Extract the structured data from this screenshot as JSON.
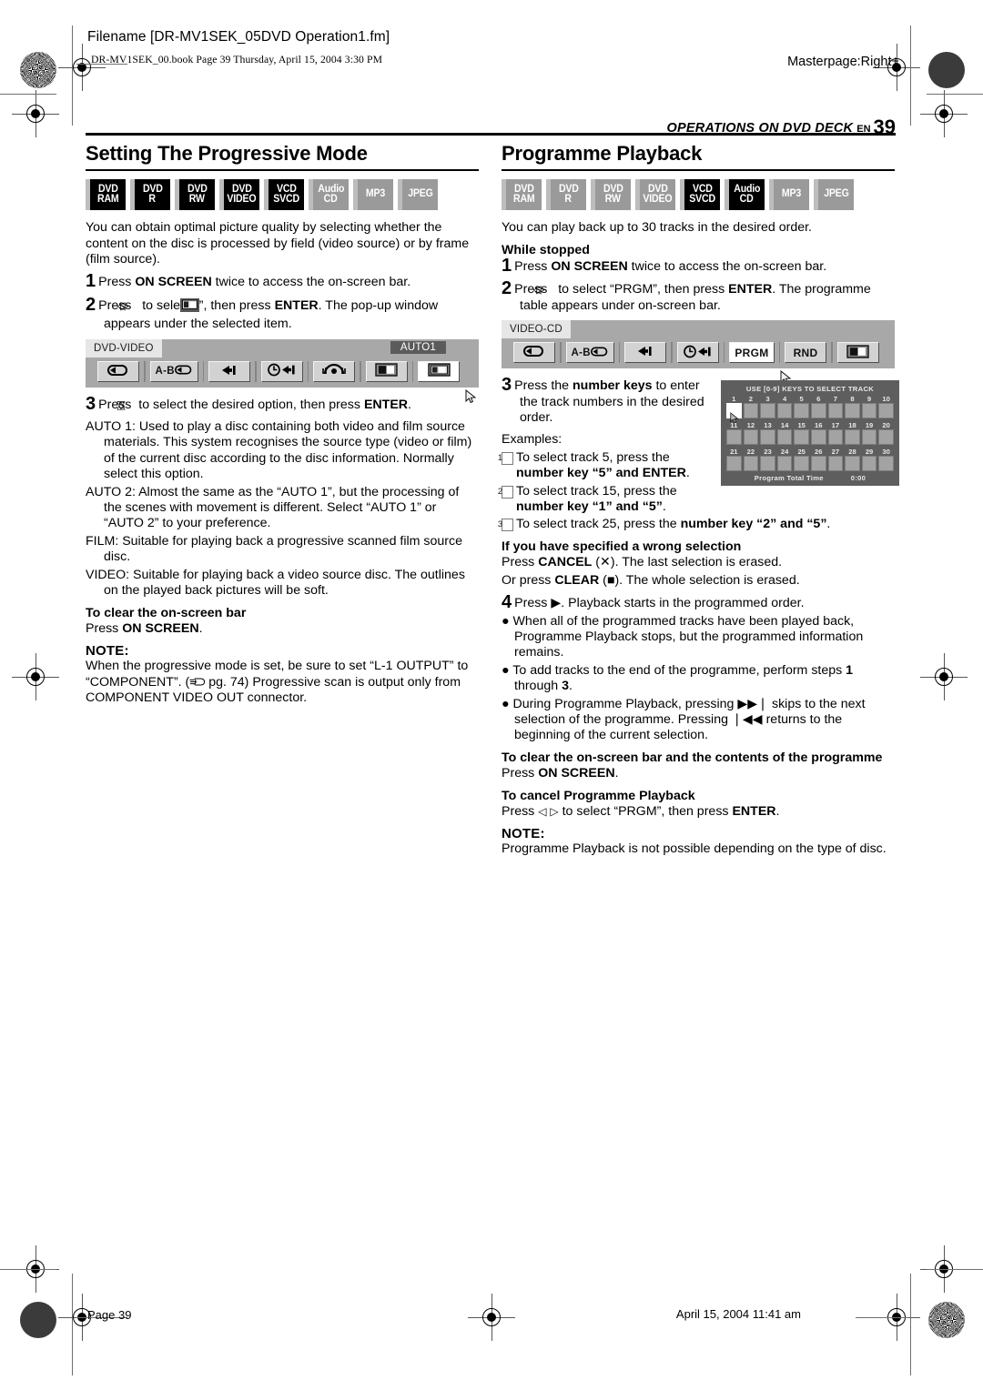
{
  "page_frame": {
    "filename_line": "Filename [DR-MV1SEK_05DVD Operation1.fm]",
    "book_line": "DR-MV1SEK_00.book  Page 39  Thursday, April 15, 2004  3:30 PM",
    "masterpage": "Masterpage:Right+",
    "running_head": "OPERATIONS ON DVD DECK",
    "running_head_en": "EN",
    "page_number": "39",
    "footer_page": "Page 39",
    "footer_date": "April 15, 2004 11:41 am"
  },
  "left_column": {
    "title": "Setting The Progressive Mode",
    "badges": [
      {
        "l1": "DVD",
        "l2": "RAM",
        "state": "on"
      },
      {
        "l1": "DVD",
        "l2": "R",
        "state": "on"
      },
      {
        "l1": "DVD",
        "l2": "RW",
        "state": "on"
      },
      {
        "l1": "DVD",
        "l2": "VIDEO",
        "state": "on"
      },
      {
        "l1": "VCD",
        "l2": "SVCD",
        "state": "on"
      },
      {
        "l1": "Audio",
        "l2": "CD",
        "state": "off"
      },
      {
        "l1": "MP3",
        "l2": "",
        "state": "off"
      },
      {
        "l1": "JPEG",
        "l2": "",
        "state": "off"
      }
    ],
    "intro": "You can obtain optimal picture quality by selecting whether the content on the disc is processed by field (video source) or by frame (film source).",
    "step1_num": "1",
    "step1_a": "Press ",
    "step1_b": "ON SCREEN",
    "step1_c": " twice to access the on-screen bar.",
    "step2_num": "2",
    "step2_a": "Press ",
    "step2_b": " to select “",
    "step2_c": "”, then press ",
    "step2_d": "ENTER",
    "step2_e": ". The pop-up window appears under the selected item.",
    "osb": {
      "disc_label": "DVD-VIDEO",
      "mode_label": "AUTO1",
      "buttons": [
        "repeat-icon",
        "A-B",
        "skip-icon",
        "time-skip-icon",
        "audio-icon",
        "screen-icon",
        "progressive-icon"
      ],
      "ab_label": "A-B",
      "selected_index": 6
    },
    "step3_num": "3",
    "step3_a": "Press ",
    "step3_b": " to select the desired option, then press ",
    "step3_c": "ENTER",
    "step3_d": ".",
    "opt_auto1_label": "AUTO 1:",
    "opt_auto1_text": " Used to play a disc containing both video and film source materials. This system recognises the source type (video or film) of the current disc according to the disc information. Normally select this option.",
    "opt_auto2_label": "AUTO 2:",
    "opt_auto2_text": " Almost the same as the “AUTO 1”, but the processing of the scenes with movement is different. Select “AUTO 1” or “AUTO 2” to your preference.",
    "opt_film_label": "FILM:",
    "opt_film_text": " Suitable for playing back a progressive scanned film source disc.",
    "opt_video_label": "VIDEO:",
    "opt_video_text": " Suitable for playing back a video source disc. The outlines on the played back pictures will be soft.",
    "clear_head": "To clear the on-screen bar",
    "clear_a": "Press ",
    "clear_b": "ON SCREEN",
    "clear_c": ".",
    "note_head": "NOTE:",
    "note_a": "When the progressive mode is set, be sure to set “L-1 OUTPUT” to “COMPONENT”. (",
    "note_pg": " pg. 74) Progressive scan is output only from COMPONENT VIDEO OUT connector."
  },
  "right_column": {
    "title": "Programme Playback",
    "badges": [
      {
        "l1": "DVD",
        "l2": "RAM",
        "state": "off"
      },
      {
        "l1": "DVD",
        "l2": "R",
        "state": "off"
      },
      {
        "l1": "DVD",
        "l2": "RW",
        "state": "off"
      },
      {
        "l1": "DVD",
        "l2": "VIDEO",
        "state": "off"
      },
      {
        "l1": "VCD",
        "l2": "SVCD",
        "state": "on"
      },
      {
        "l1": "Audio",
        "l2": "CD",
        "state": "on"
      },
      {
        "l1": "MP3",
        "l2": "",
        "state": "off"
      },
      {
        "l1": "JPEG",
        "l2": "",
        "state": "off"
      }
    ],
    "intro": "You can play back up to 30 tracks in the desired order.",
    "while_stopped": "While stopped",
    "step1_num": "1",
    "step1_a": "Press ",
    "step1_b": "ON SCREEN",
    "step1_c": " twice to access the on-screen bar.",
    "step2_num": "2",
    "step2_a": "Press ",
    "step2_b": " to select “PRGM”, then press ",
    "step2_c": "ENTER",
    "step2_d": ". The programme table appears under on-screen bar.",
    "osb": {
      "disc_label": "VIDEO-CD",
      "buttons": [
        "repeat-icon",
        "A-B",
        "skip-icon",
        "time-skip-icon",
        "PRGM",
        "RND",
        "screen-icon"
      ],
      "ab_label": "A-B",
      "prgm_label": "PRGM",
      "rnd_label": "RND",
      "selected_index": 4
    },
    "step3_num": "3",
    "step3_a": "Press the ",
    "step3_b": "number keys",
    "step3_c": " to enter the track numbers in the desired order.",
    "examples_label": "Examples:",
    "ex1_num": "1",
    "ex1_a": "To select track 5, press the ",
    "ex1_b": "number key “5” and ENTER",
    "ex1_c": ".",
    "ex2_num": "2",
    "ex2_a": "To select track 15, press the ",
    "ex2_b": "number key “1” and “5”",
    "ex2_c": ".",
    "ex3_num": "3",
    "ex3_a": "To select track 25, press the ",
    "ex3_b": "number key “2” and “5”",
    "ex3_c": ".",
    "wrong_head": "If you have specified a wrong selection",
    "wrong_1a": "Press ",
    "wrong_1b": "CANCEL",
    "wrong_1c": " (✕). The last selection is erased.",
    "wrong_2a": "Or press ",
    "wrong_2b": "CLEAR",
    "wrong_2c": " (■). The whole selection is erased.",
    "step4_num": "4",
    "step4_a": "Press ▶. Playback starts in the programmed order.",
    "bullet1": "When all of the programmed tracks have been played back, Programme Playback stops, but the programmed information remains.",
    "bullet2a": "To add tracks to the end of the programme, perform steps ",
    "bullet2b": "1",
    "bullet2c": " through ",
    "bullet2d": "3",
    "bullet2e": ".",
    "bullet3a": "During Programme Playback, pressing ▶▶❘ skips to the next selection of the programme. Pressing ❘◀◀ returns to the beginning of the current selection.",
    "clearbar_head": "To clear the on-screen bar and the contents of the programme",
    "clearbar_a": "Press ",
    "clearbar_b": "ON SCREEN",
    "clearbar_c": ".",
    "cancel_head": "To cancel Programme Playback",
    "cancel_a": "Press ",
    "cancel_b": " to select “PRGM”, then press ",
    "cancel_c": "ENTER",
    "cancel_d": ".",
    "note_head": "NOTE:",
    "note_text": "Programme Playback is not possible depending on the type of disc.",
    "program_table": {
      "title": "USE [0-9] KEYS TO SELECT TRACK",
      "row1": [
        "1",
        "2",
        "3",
        "4",
        "5",
        "6",
        "7",
        "8",
        "9",
        "10"
      ],
      "row2": [
        "11",
        "12",
        "13",
        "14",
        "15",
        "16",
        "17",
        "18",
        "19",
        "20"
      ],
      "row3": [
        "21",
        "22",
        "23",
        "24",
        "25",
        "26",
        "27",
        "28",
        "29",
        "30"
      ],
      "active_cell": "1",
      "footer_label": "Program Total Time",
      "footer_time": "0:00"
    }
  },
  "colors": {
    "badge_on_bg": "#000000",
    "badge_off_bg": "#9a9a9a",
    "osb_bg": "#a8a8a8",
    "table_bg": "#5e5e5e"
  }
}
